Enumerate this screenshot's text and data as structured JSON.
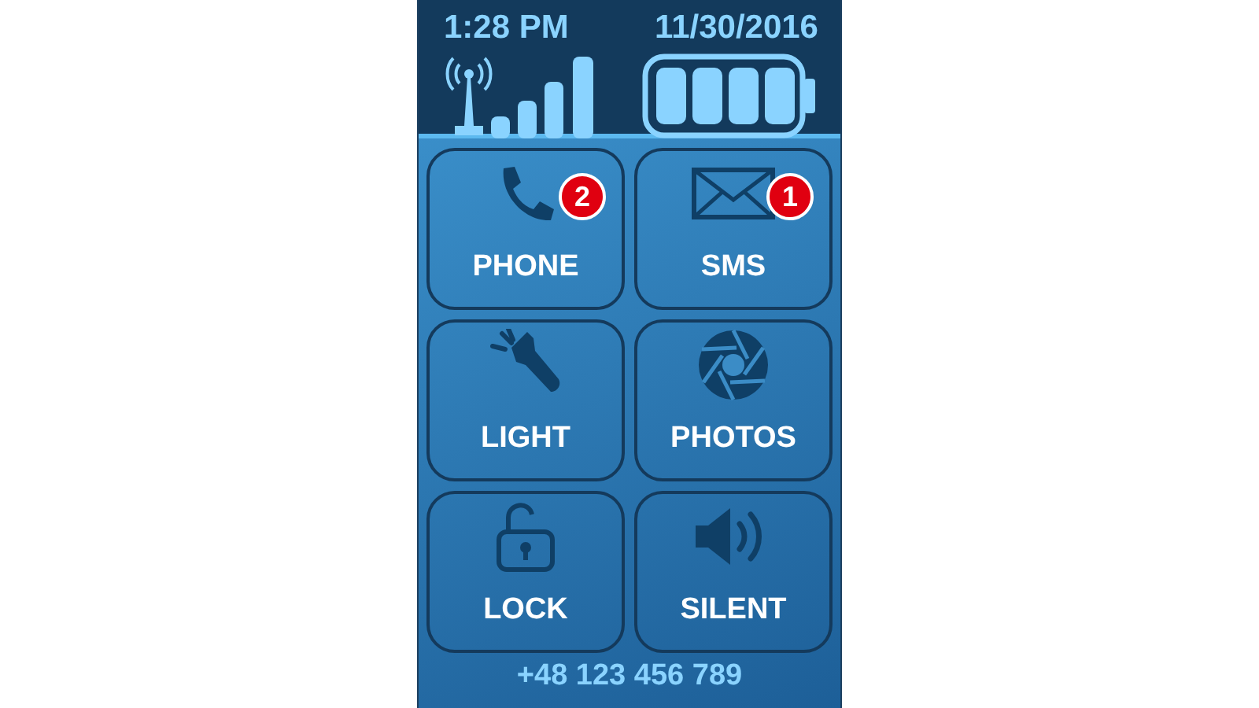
{
  "status_bar": {
    "time": "1:28 PM",
    "date": "11/30/2016"
  },
  "tiles": [
    {
      "kind": "phone",
      "label": "PHONE",
      "badge": "2"
    },
    {
      "kind": "sms",
      "label": "SMS",
      "badge": "1"
    },
    {
      "kind": "light",
      "label": "LIGHT"
    },
    {
      "kind": "photos",
      "label": "PHOTOS"
    },
    {
      "kind": "lock",
      "label": "LOCK"
    },
    {
      "kind": "silent",
      "label": "SILENT"
    }
  ],
  "footer": {
    "phone_number": "+48 123 456 789"
  }
}
